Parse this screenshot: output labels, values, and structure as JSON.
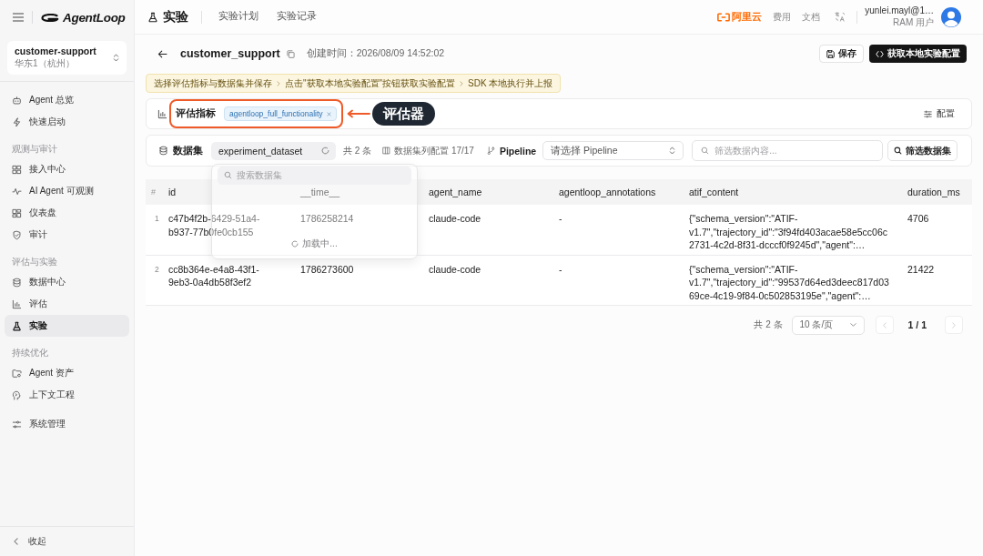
{
  "sidebar": {
    "logo": "AgentLoop",
    "project": {
      "name": "customer-support",
      "region": "华东1（杭州）"
    },
    "nav_groups": [
      {
        "items": [
          {
            "label": "Agent 总览",
            "selected": false
          },
          {
            "label": "快速启动",
            "selected": false
          }
        ]
      },
      {
        "title": "观测与审计",
        "items": [
          {
            "label": "接入中心",
            "selected": false
          },
          {
            "label": "AI Agent 可观测",
            "selected": false
          },
          {
            "label": "仪表盘",
            "selected": false
          },
          {
            "label": "审计",
            "selected": false
          }
        ]
      },
      {
        "title": "评估与实验",
        "items": [
          {
            "label": "数据中心",
            "selected": false
          },
          {
            "label": "评估",
            "selected": false
          },
          {
            "label": "实验",
            "selected": true
          }
        ]
      },
      {
        "title": "持续优化",
        "items": [
          {
            "label": "Agent 资产",
            "selected": false
          },
          {
            "label": "上下文工程",
            "selected": false
          }
        ]
      },
      {
        "items": [
          {
            "label": "系统管理",
            "selected": false
          }
        ]
      }
    ],
    "collapse": "收起"
  },
  "header": {
    "title": "实验",
    "tabs": [
      {
        "label": "实验计划",
        "selected": false
      },
      {
        "label": "实验记录",
        "selected": false
      }
    ],
    "brand": "阿里云",
    "links": [
      "费用",
      "文档"
    ],
    "user": {
      "name": "yunlei.mayl@1…",
      "role": "RAM 用户"
    }
  },
  "page": {
    "title": "customer_support",
    "created": "创建时间：2026/08/09 14:52:02",
    "actions": [
      {
        "label": "保存",
        "kind": "secondary"
      },
      {
        "label": "获取本地实验配置",
        "kind": "primary"
      }
    ]
  },
  "steps": [
    "选择评估指标与数据集并保存",
    "点击\"获取本地实验配置\"按钮获取实验配置",
    "SDK 本地执行并上报"
  ],
  "metrics": {
    "label": "评估指标",
    "tags": [
      "agentloop_full_functionality"
    ],
    "callout": "评估器",
    "config": "配置"
  },
  "dataset": {
    "label": "数据集",
    "value": "experiment_dataset",
    "count": "共 2 条",
    "columns_config": "数据集列配置 17/17",
    "pipeline_label": "Pipeline",
    "pipeline_placeholder": "请选择 Pipeline",
    "filter_placeholder": "筛选数据内容...",
    "filter_button": "筛选数据集",
    "dropdown": {
      "search_placeholder": "搜索数据集",
      "status": "加载中..."
    }
  },
  "table": {
    "columns": [
      "#",
      "id",
      "__time__",
      "agent_name",
      "agentloop_annotations",
      "atif_content",
      "duration_ms"
    ],
    "rows": [
      {
        "index": "1",
        "id": "c47b4f2b-6429-51a4-b937-77b0fe0cb155",
        "time": "1786258214",
        "agent_name": "claude-code",
        "annotations": "-",
        "atif_content": [
          "{\"schema_version\":\"ATIF-",
          "v1.7\",\"trajectory_id\":\"3f94fd403acae58e5cc06c",
          "2731-4c2d-8f31-dcccf0f9245d\",\"agent\":…"
        ],
        "duration_ms": "4706"
      },
      {
        "index": "2",
        "id": "cc8b364e-e4a8-43f1-9eb3-0a4db58f3ef2",
        "time": "1786273600",
        "agent_name": "claude-code",
        "annotations": "-",
        "atif_content": [
          "{\"schema_version\":\"ATIF-",
          "v1.7\",\"trajectory_id\":\"99537d64ed3deec817d03",
          "69ce-4c19-9f84-0c502853195e\",\"agent\":…"
        ],
        "duration_ms": "21422"
      }
    ]
  },
  "pagination": {
    "total": "共 2 条",
    "page_size": "10 条/页",
    "page": "1 / 1",
    "prev_disabled": true,
    "next_disabled": true
  }
}
